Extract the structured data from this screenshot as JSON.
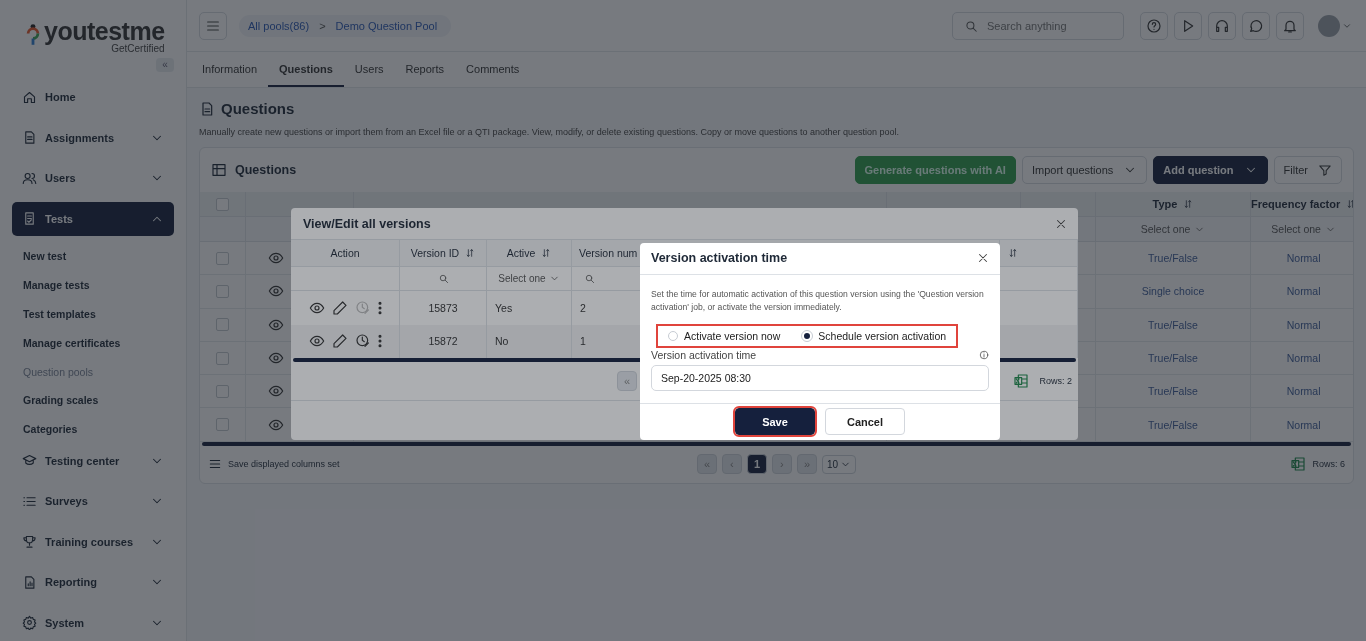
{
  "logo": {
    "name": "youtestme",
    "tagline": "GetCertified"
  },
  "sidebar": {
    "collapse": "«",
    "items": [
      {
        "label": "Home",
        "selected": false
      },
      {
        "label": "Assignments",
        "expanded": false,
        "selected": false
      },
      {
        "label": "Users",
        "expanded": false,
        "selected": false
      },
      {
        "label": "Tests",
        "expanded": true,
        "selected": true,
        "children": [
          {
            "label": "New test",
            "selected": false
          },
          {
            "label": "Manage tests",
            "selected": false
          },
          {
            "label": "Test templates",
            "selected": false
          },
          {
            "label": "Manage certificates",
            "selected": false
          },
          {
            "label": "Question pools",
            "selected": true
          },
          {
            "label": "Grading scales",
            "selected": false
          },
          {
            "label": "Categories",
            "selected": false
          }
        ]
      },
      {
        "label": "Testing center",
        "expanded": false,
        "selected": false
      },
      {
        "label": "Surveys",
        "expanded": false,
        "selected": false
      },
      {
        "label": "Training courses",
        "expanded": false,
        "selected": false
      },
      {
        "label": "Reporting",
        "expanded": false,
        "selected": false
      },
      {
        "label": "System",
        "expanded": false,
        "selected": false
      }
    ]
  },
  "breadcrumb": {
    "items": [
      "All pools(86)",
      "Demo Question Pool"
    ],
    "separator": ">"
  },
  "search": {
    "placeholder": "Search anything"
  },
  "tabs": [
    {
      "label": "Information",
      "selected": false
    },
    {
      "label": "Questions",
      "selected": true
    },
    {
      "label": "Users",
      "selected": false
    },
    {
      "label": "Reports",
      "selected": false
    },
    {
      "label": "Comments",
      "selected": false
    }
  ],
  "page": {
    "title": "Questions",
    "description": "Manually create new questions or import them from an Excel file or a QTI package. View, modify, or delete existing questions. Copy or move questions to another question pool."
  },
  "card": {
    "title": "Questions",
    "buttons": [
      {
        "label": "Generate questions with AI",
        "kind": "ai"
      },
      {
        "label": "Import questions",
        "kind": "dropdown"
      },
      {
        "label": "Add question",
        "kind": "primary"
      },
      {
        "label": "Filter",
        "kind": "filter"
      }
    ]
  },
  "table": {
    "all_checked": false,
    "columns": [
      {
        "label": "Type",
        "filter": "Select one"
      },
      {
        "label": "Frequency factor",
        "filter": "Select one"
      }
    ],
    "rows": [
      {
        "checked": false,
        "type": "True/False",
        "frequency": "Normal"
      },
      {
        "checked": false,
        "type": "Single choice",
        "frequency": "Normal"
      },
      {
        "checked": false,
        "type": "True/False",
        "frequency": "Normal"
      },
      {
        "checked": false,
        "type": "True/False",
        "frequency": "Normal"
      },
      {
        "checked": false,
        "type": "True/False",
        "frequency": "Normal"
      },
      {
        "checked": false,
        "type": "True/False",
        "frequency": "Normal"
      }
    ],
    "footer": {
      "save_columns": "Save displayed columns set",
      "pager": [
        {
          "label": "«",
          "selected": false,
          "disabled": true
        },
        {
          "label": "‹",
          "selected": false,
          "disabled": true
        },
        {
          "label": "1",
          "selected": true,
          "disabled": false
        },
        {
          "label": "›",
          "selected": false,
          "disabled": true
        },
        {
          "label": "»",
          "selected": false,
          "disabled": true
        }
      ],
      "page_size": "10",
      "rows": "Rows: 6"
    }
  },
  "versions_dialog": {
    "title": "View/Edit all versions",
    "columns": [
      {
        "label": "Action",
        "sortable": false,
        "search_filter": false
      },
      {
        "label": "Version ID",
        "sortable": true,
        "search_filter": true
      },
      {
        "label": "Active",
        "sortable": true,
        "placeholder": "Select one"
      },
      {
        "label": "Version num",
        "sortable": false,
        "search_filter": true
      },
      {
        "sortable": true,
        "search_filter": false
      }
    ],
    "rows": [
      {
        "version_id": "15873",
        "active": "Yes",
        "version_number": "2",
        "schedule_disabled": true
      },
      {
        "version_id": "15872",
        "active": "No",
        "version_number": "1",
        "schedule_disabled": false
      }
    ],
    "footer": {
      "first_page": "«",
      "rows": "Rows: 2"
    }
  },
  "activation_dialog": {
    "title": "Version activation time",
    "description": "Set the time for automatic activation of this question version using the 'Question version activation' job, or activate the version immediately.",
    "options_highlighted": true,
    "options": [
      {
        "label": "Activate version now",
        "selected": false
      },
      {
        "label": "Schedule version activation",
        "selected": true
      }
    ],
    "field": {
      "label": "Version activation time",
      "value": "Sep-20-2025 08:30"
    },
    "buttons": [
      {
        "label": "Save",
        "kind": "primary",
        "highlighted": true
      },
      {
        "label": "Cancel",
        "kind": "secondary",
        "highlighted": false
      }
    ]
  }
}
